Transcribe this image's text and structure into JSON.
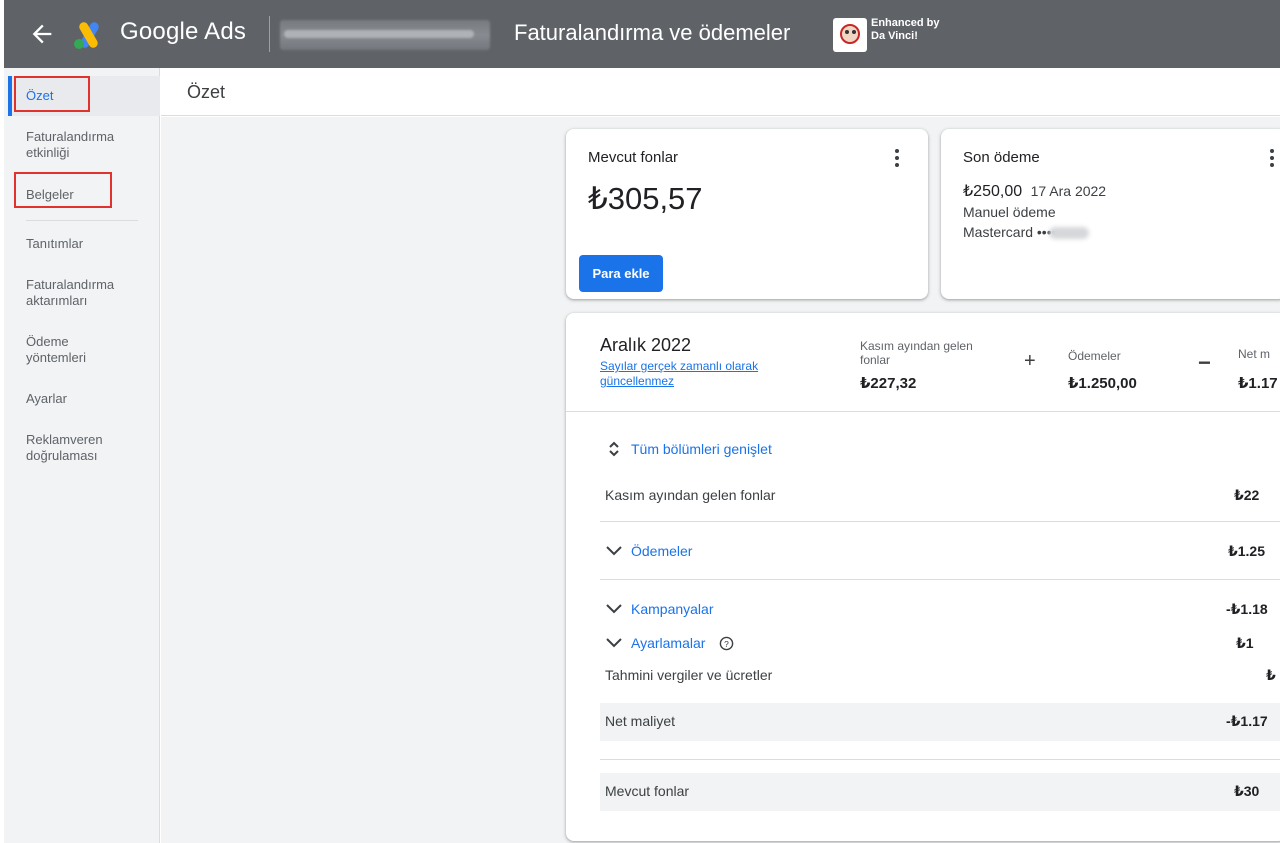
{
  "header": {
    "brand": "Google Ads",
    "page_title": "Faturalandırma ve ödemeler",
    "enhanced_line1": "Enhanced by",
    "enhanced_line2": "Da Vinci!"
  },
  "sidebar": {
    "items": [
      {
        "label": "Özet"
      },
      {
        "label": "Faturalandırma etkinliği"
      },
      {
        "label": "Belgeler"
      },
      {
        "label": "Tanıtımlar"
      },
      {
        "label": "Faturalandırma aktarımları"
      },
      {
        "label": "Ödeme yöntemleri"
      },
      {
        "label": "Ayarlar"
      },
      {
        "label": "Reklamveren doğrulaması"
      }
    ]
  },
  "subheader": {
    "title": "Özet"
  },
  "funds_card": {
    "title": "Mevcut fonlar",
    "amount": "₺305,57",
    "button": "Para ekle"
  },
  "last_payment_card": {
    "title": "Son ödeme",
    "amount": "₺250,00",
    "date": "17 Ara 2022",
    "type": "Manuel ödeme",
    "card": "Mastercard ••••"
  },
  "summary": {
    "period": "Aralık 2022",
    "note": "Sayılar gerçek zamanlı olarak güncellenmez",
    "col1_label": "Kasım ayından gelen fonlar",
    "col1_value": "₺227,32",
    "plus": "+",
    "col2_label": "Ödemeler",
    "col2_value": "₺1.250,00",
    "minus": "−",
    "col3_label": "Net m",
    "col3_value": "₺1.17",
    "expand_all": "Tüm bölümleri genişlet",
    "rows": {
      "carryover_label": "Kasım ayından gelen fonlar",
      "carryover_value": "₺22",
      "payments_label": "Ödemeler",
      "payments_value": "₺1.25",
      "campaigns_label": "Kampanyalar",
      "campaigns_value": "-₺1.18",
      "adjustments_label": "Ayarlamalar",
      "adjustments_value": "₺1",
      "taxes_label": "Tahmini vergiler ve ücretler",
      "taxes_value": "₺",
      "net_label": "Net maliyet",
      "net_value": "-₺1.17",
      "funds_label": "Mevcut fonlar",
      "funds_value": "₺30"
    }
  }
}
